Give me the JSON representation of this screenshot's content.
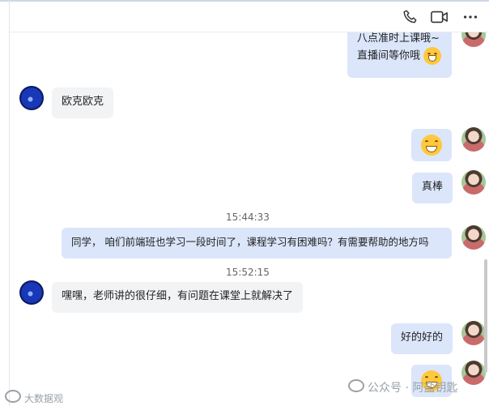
{
  "header": {
    "phone_icon": "phone-icon",
    "video_icon": "video-camera-icon",
    "more_icon": "more-horizontal-icon"
  },
  "messages": [
    {
      "side": "right",
      "lines": [
        "八点准时上课哦~",
        "直播间等你哦"
      ],
      "emoji": "shy-smile-emoji"
    },
    {
      "side": "left",
      "text": "欧克欧克"
    },
    {
      "side": "right",
      "emoji": "grin-emoji"
    },
    {
      "side": "right",
      "text": "真棒"
    },
    {
      "time": "15:44:33"
    },
    {
      "side": "right",
      "text": "同学， 咱们前端班也学习一段时间了，课程学习有困难吗？有需要帮助的地方吗"
    },
    {
      "time": "15:52:15"
    },
    {
      "side": "left",
      "text": "嘿嘿，老师讲的很仔细，有问题在课堂上就解决了"
    },
    {
      "side": "right",
      "text": "好的好的"
    },
    {
      "side": "right",
      "emoji": "shy-smile-emoji"
    }
  ],
  "watermarks": {
    "bottom_left": "大数据观",
    "bottom_right": "公众号 · 阿盐钥匙"
  }
}
